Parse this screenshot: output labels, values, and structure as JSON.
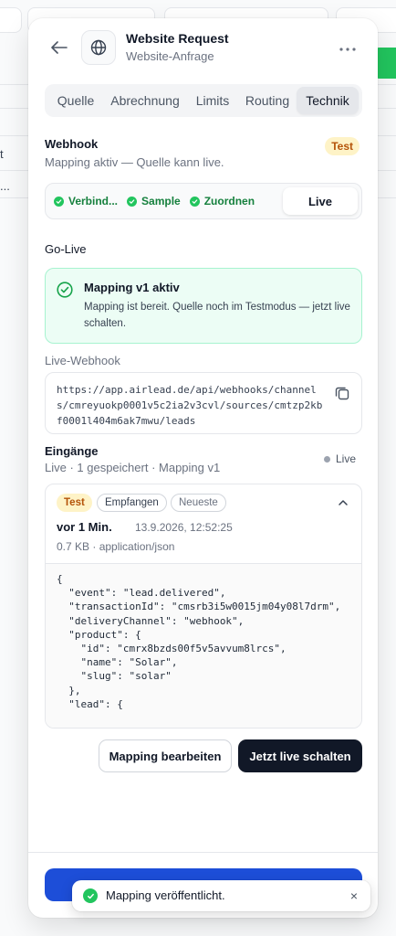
{
  "header": {
    "title": "Website Request",
    "subtitle": "Website-Anfrage"
  },
  "tabs": [
    {
      "label": "Quelle"
    },
    {
      "label": "Abrechnung"
    },
    {
      "label": "Limits"
    },
    {
      "label": "Routing"
    },
    {
      "label": "Technik",
      "active": true
    }
  ],
  "webhook": {
    "title": "Webhook",
    "subtitle": "Mapping aktiv — Quelle kann live.",
    "badge": "Test"
  },
  "steps": [
    {
      "label": "Verbind...",
      "done": true
    },
    {
      "label": "Sample",
      "done": true
    },
    {
      "label": "Zuordnen",
      "done": true
    }
  ],
  "steps_live_label": "Live",
  "golive": {
    "title": "Go-Live",
    "success_title": "Mapping v1 aktiv",
    "success_text": "Mapping ist bereit. Quelle noch im Testmodus — jetzt live schalten."
  },
  "live_webhook": {
    "label": "Live-Webhook",
    "url": "https://app.airlead.de/api/webhooks/channels/cmreyuokp0001v5c2ia2v3cvl/sources/cmtzp2kbf0001l404m6ak7mwu/leads"
  },
  "inputs": {
    "title": "Eingänge",
    "subtitle": "Live · 1 gespeichert · Mapping v1",
    "live_label": "Live"
  },
  "entry": {
    "chip_test": "Test",
    "chip_received": "Empfangen",
    "chip_newest": "Neueste",
    "time": "vor 1 Min.",
    "date": "13.9.2026, 12:52:25",
    "meta": "0.7 KB · application/json",
    "payload": "{\n  \"event\": \"lead.delivered\",\n  \"transactionId\": \"cmsrb3i5w0015jm04y08l7drm\",\n  \"deliveryChannel\": \"webhook\",\n  \"product\": {\n    \"id\": \"cmrx8bzds00f5v5avvum8lrcs\",\n    \"name\": \"Solar\",\n    \"slug\": \"solar\"\n  },\n  \"lead\": {"
  },
  "actions": {
    "edit_label": "Mapping bearbeiten",
    "golive_label": "Jetzt live schalten"
  },
  "toast": {
    "text": "Mapping veröffentlicht.",
    "close": "×"
  },
  "bg": {
    "row1_text": "t",
    "row2_text": "..."
  },
  "colors": {
    "accent_dark": "#111827",
    "success": "#22c55e",
    "warning_bg": "#fef3c7",
    "primary_blue": "#1d4ed8"
  }
}
